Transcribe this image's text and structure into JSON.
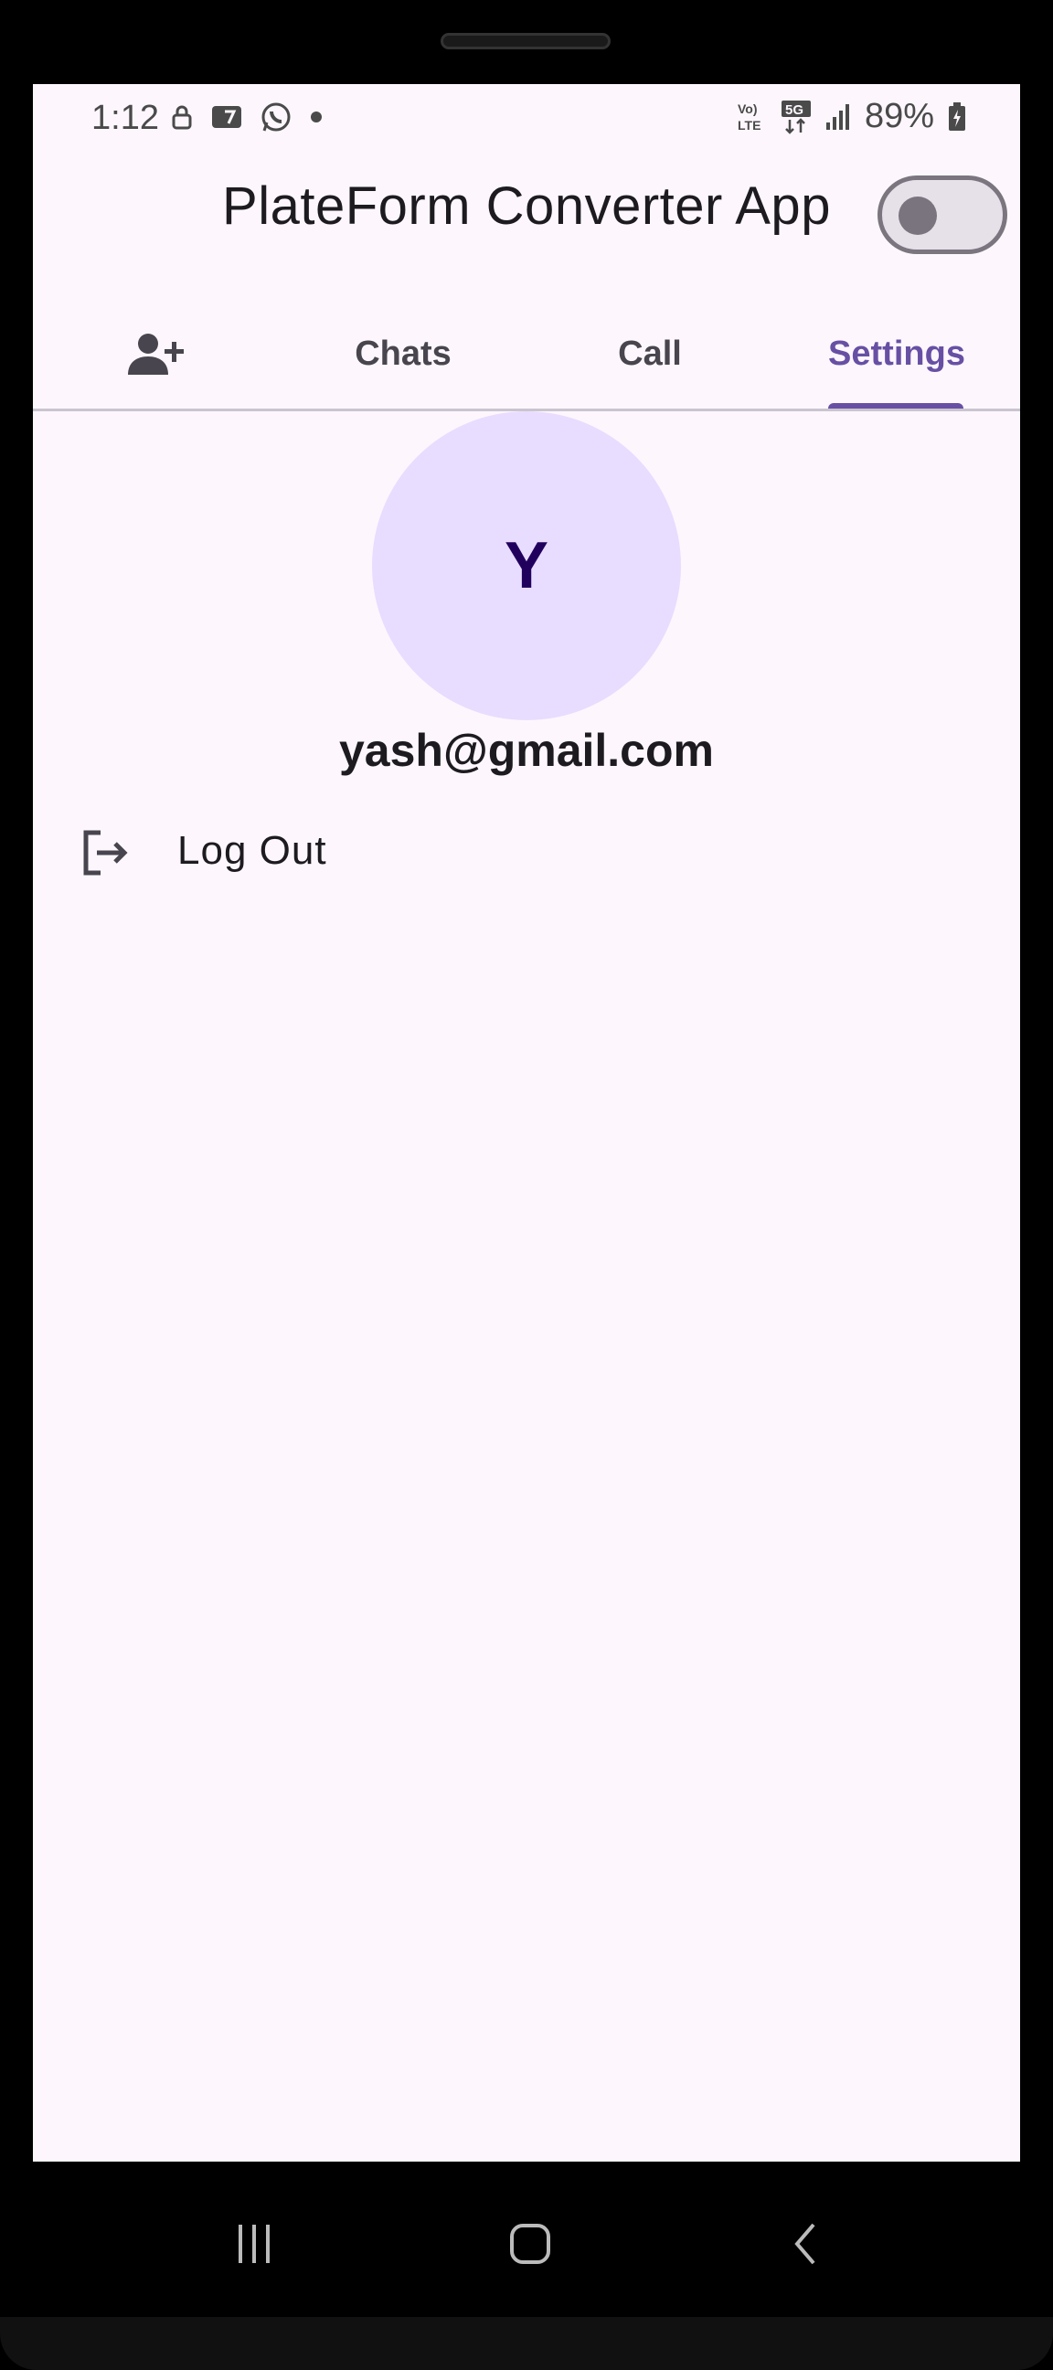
{
  "status_bar": {
    "time": "1:12",
    "battery": "89%",
    "icons": [
      "lock-icon",
      "notification-icon",
      "whatsapp-icon",
      "dot-icon",
      "volte-icon",
      "5g-icon",
      "signal-icon",
      "battery-charging-icon"
    ]
  },
  "app_bar": {
    "title": "PlateForm Converter App",
    "theme_toggle_on": false
  },
  "tabs": [
    {
      "label": "",
      "icon": "add-person-icon"
    },
    {
      "label": "Chats"
    },
    {
      "label": "Call"
    },
    {
      "label": "Settings"
    }
  ],
  "active_tab": "Settings",
  "profile": {
    "avatar_letter": "Y",
    "email": "yash@gmail.com"
  },
  "settings_items": [
    {
      "label": "Log Out",
      "icon": "logout-icon"
    }
  ],
  "colors": {
    "primary": "#6750a4",
    "background": "#fdf7fd",
    "avatar_bg": "#e8ddff"
  }
}
